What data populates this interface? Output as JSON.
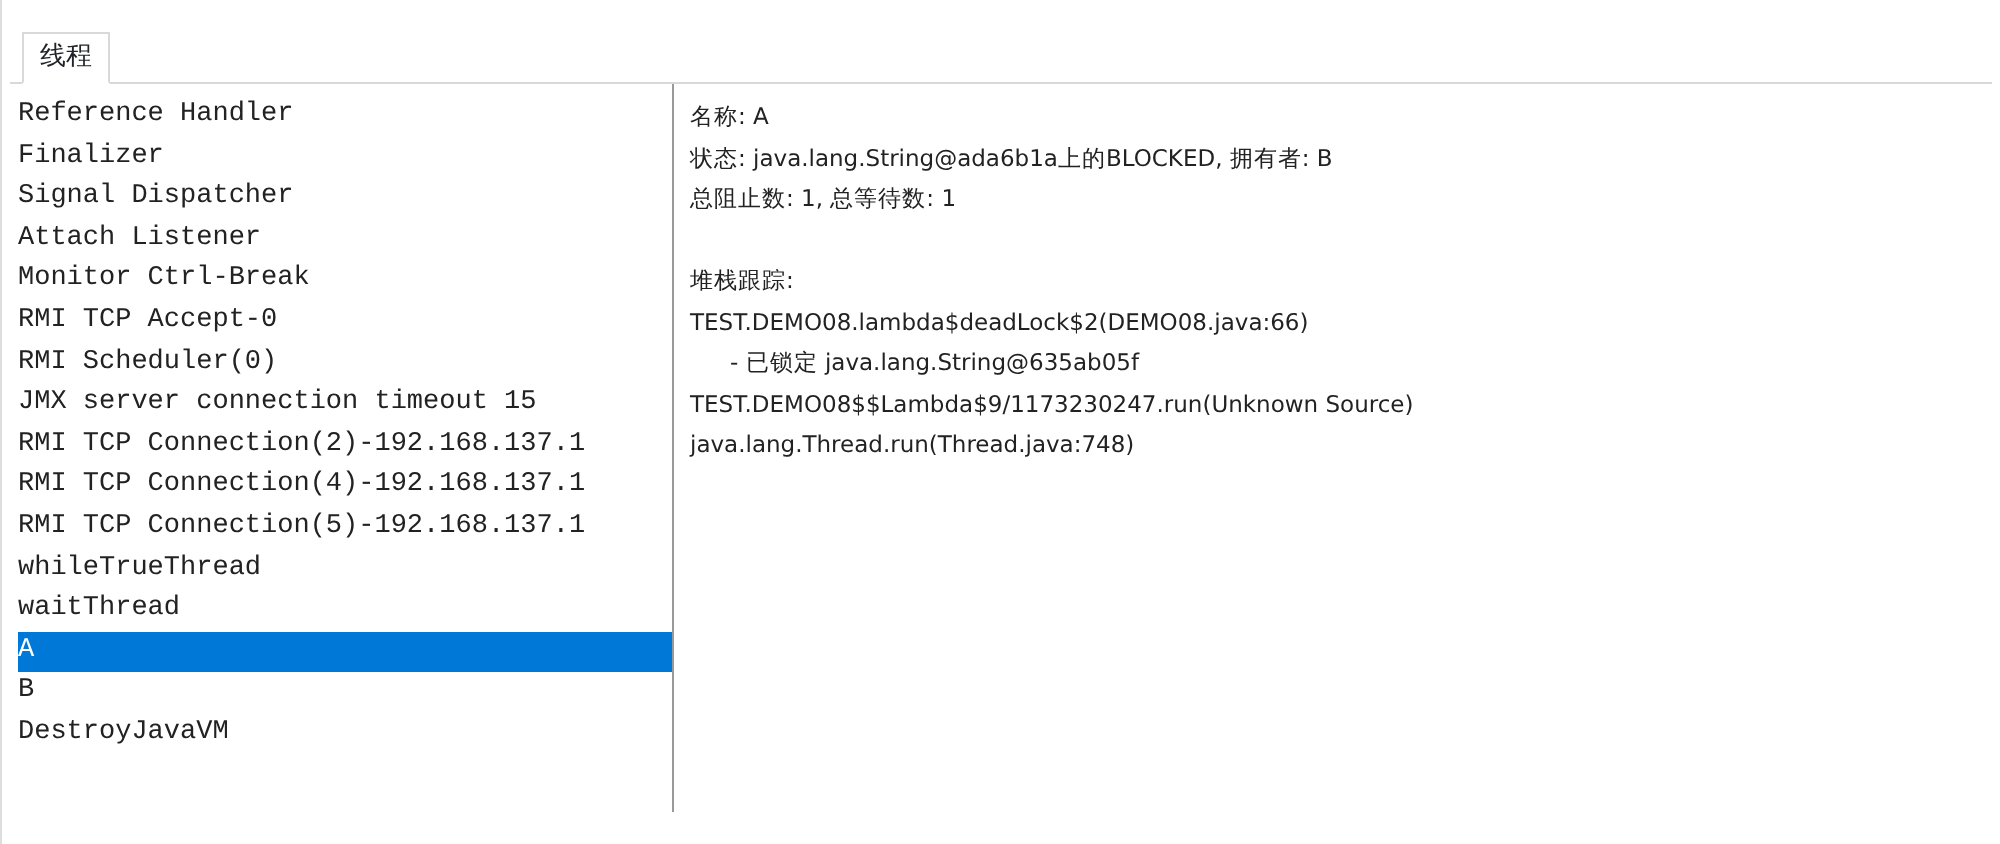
{
  "tabs": [
    {
      "label": "线程",
      "selected": true
    }
  ],
  "threads": [
    {
      "name": "Reference Handler",
      "selected": false
    },
    {
      "name": "Finalizer",
      "selected": false
    },
    {
      "name": "Signal Dispatcher",
      "selected": false
    },
    {
      "name": "Attach Listener",
      "selected": false
    },
    {
      "name": "Monitor Ctrl-Break",
      "selected": false
    },
    {
      "name": "RMI TCP Accept-0",
      "selected": false
    },
    {
      "name": "RMI Scheduler(0)",
      "selected": false
    },
    {
      "name": "JMX server connection timeout 15",
      "selected": false
    },
    {
      "name": "RMI TCP Connection(2)-192.168.137.1",
      "selected": false
    },
    {
      "name": "RMI TCP Connection(4)-192.168.137.1",
      "selected": false
    },
    {
      "name": "RMI TCP Connection(5)-192.168.137.1",
      "selected": false
    },
    {
      "name": "whileTrueThread",
      "selected": false
    },
    {
      "name": "waitThread",
      "selected": false
    },
    {
      "name": "A",
      "selected": true
    },
    {
      "name": "B",
      "selected": false
    },
    {
      "name": "DestroyJavaVM",
      "selected": false
    }
  ],
  "details": {
    "info": [
      "名称: A",
      "状态: java.lang.String@ada6b1a上的BLOCKED, 拥有者: B",
      "总阻止数: 1, 总等待数: 1"
    ],
    "stack_title": "堆栈跟踪:",
    "stack": [
      {
        "kind": "frame",
        "text": "TEST.DEMO08.lambda$deadLock$2(DEMO08.java:66)"
      },
      {
        "kind": "lock",
        "text": "- 已锁定 java.lang.String@635ab05f"
      },
      {
        "kind": "frame",
        "text": "TEST.DEMO08$$Lambda$9/1173230247.run(Unknown Source)"
      },
      {
        "kind": "frame",
        "text": "java.lang.Thread.run(Thread.java:748)"
      }
    ]
  }
}
